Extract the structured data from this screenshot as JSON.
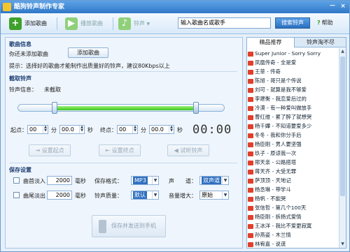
{
  "window": {
    "title": "酷狗铃声制作专家",
    "min": "－",
    "close": "×"
  },
  "toolbar": {
    "add_song": "添加歌曲",
    "play_song": "播放歌曲",
    "ringtone": "铃声",
    "ringtone_arrow": "▼"
  },
  "search": {
    "value": "输入歌曲名或歌手",
    "button": "搜索铃声"
  },
  "help": {
    "label": "帮助",
    "icon": "?"
  },
  "song_info": {
    "heading": "歌曲信息",
    "status": "你还未添加歌曲",
    "add_button": "添加歌曲",
    "hint": "提示：选择好的歌曲才能制作出质量好的铃声，建议80Kbps以上"
  },
  "cut": {
    "heading": "截取铃声",
    "info_label": "铃声信息：",
    "info_value": "未截取"
  },
  "slider": {
    "start_fraction": 0.18,
    "end_fraction": 0.86
  },
  "times": {
    "start_label": "起点：",
    "end_label": "终点：",
    "min": "分",
    "sec": "秒",
    "start_min": "00",
    "start_sec": "00.0",
    "end_min": "00",
    "end_sec": "00.0",
    "timer": "00:00"
  },
  "actions": {
    "set_start": "设置起点",
    "set_end": "设置终点",
    "preview": "试听铃声"
  },
  "save": {
    "heading": "保存设置",
    "fade_in": "曲首淡入",
    "fade_out": "曲尾淡出",
    "fade_in_ms": "2000",
    "fade_out_ms": "2000",
    "ms": "毫秒",
    "format_label": "保存格式：",
    "format_value": "MP3",
    "quality_label": "铃声质量：",
    "quality_value": "默认",
    "channel_label": "声　　道：",
    "channel_value": "双声道",
    "gain_label": "音量增大：",
    "gain_value": "原始",
    "save_button": "保存并发送到手机"
  },
  "tabs": {
    "recommended": "精品推荐",
    "more": "铃声淘不尽"
  },
  "songs": [
    "Super Junior - Sorry Sorry",
    "凤凰传奇 - 全是爱",
    "王菲 - 传奇",
    "陈旭 - 哥只是个传说",
    "刘可 - 就算是我不够爱",
    "李建衡 - 我恋爱后过的",
    "冷漠 - 有一种爱叫做放手",
    "曹红维 - 累了醉了就想哭",
    "杨千嬅 - 不知道要爱多少",
    "冬冬 - 我和你分手后",
    "杨臣刚 - 男人要坚强",
    "玖子 - 原谅我一次",
    "邢天亲 - 公路搭塔",
    "蒋天齐 - 大受无罪",
    "萨顶顶 - 天地记",
    "杨丞琳 - 带学斗",
    "杨帆 - 不能哭",
    "张信哲 - 第几个100天",
    "杨臣刚 - 拆扬式爱情",
    "王冰洋 - 我比不爱更寂寞",
    "孙燕姿 - 木兰情",
    "林宥嘉 - 说谎"
  ]
}
